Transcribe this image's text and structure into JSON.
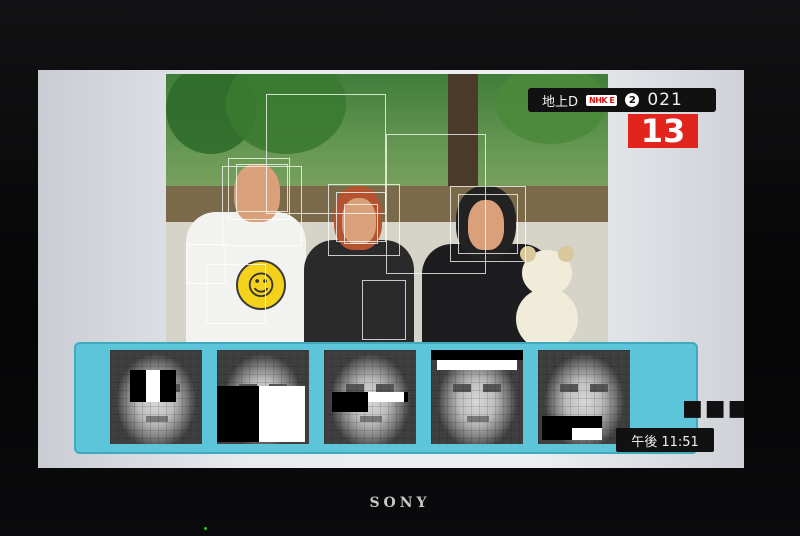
{
  "channel": {
    "broadcast_type": "地上D",
    "network_logo": "NHK E",
    "remote_button": "2",
    "channel_number": "021",
    "big_number": "13"
  },
  "clock": {
    "label": "午後 11:51"
  },
  "feature_strip": {
    "more_indicator": "■■■"
  },
  "tv": {
    "brand": "SONY"
  },
  "colors": {
    "strip_bg": "#5cc5d9",
    "channel_red": "#e1241c",
    "badge_bg": "#111111"
  }
}
